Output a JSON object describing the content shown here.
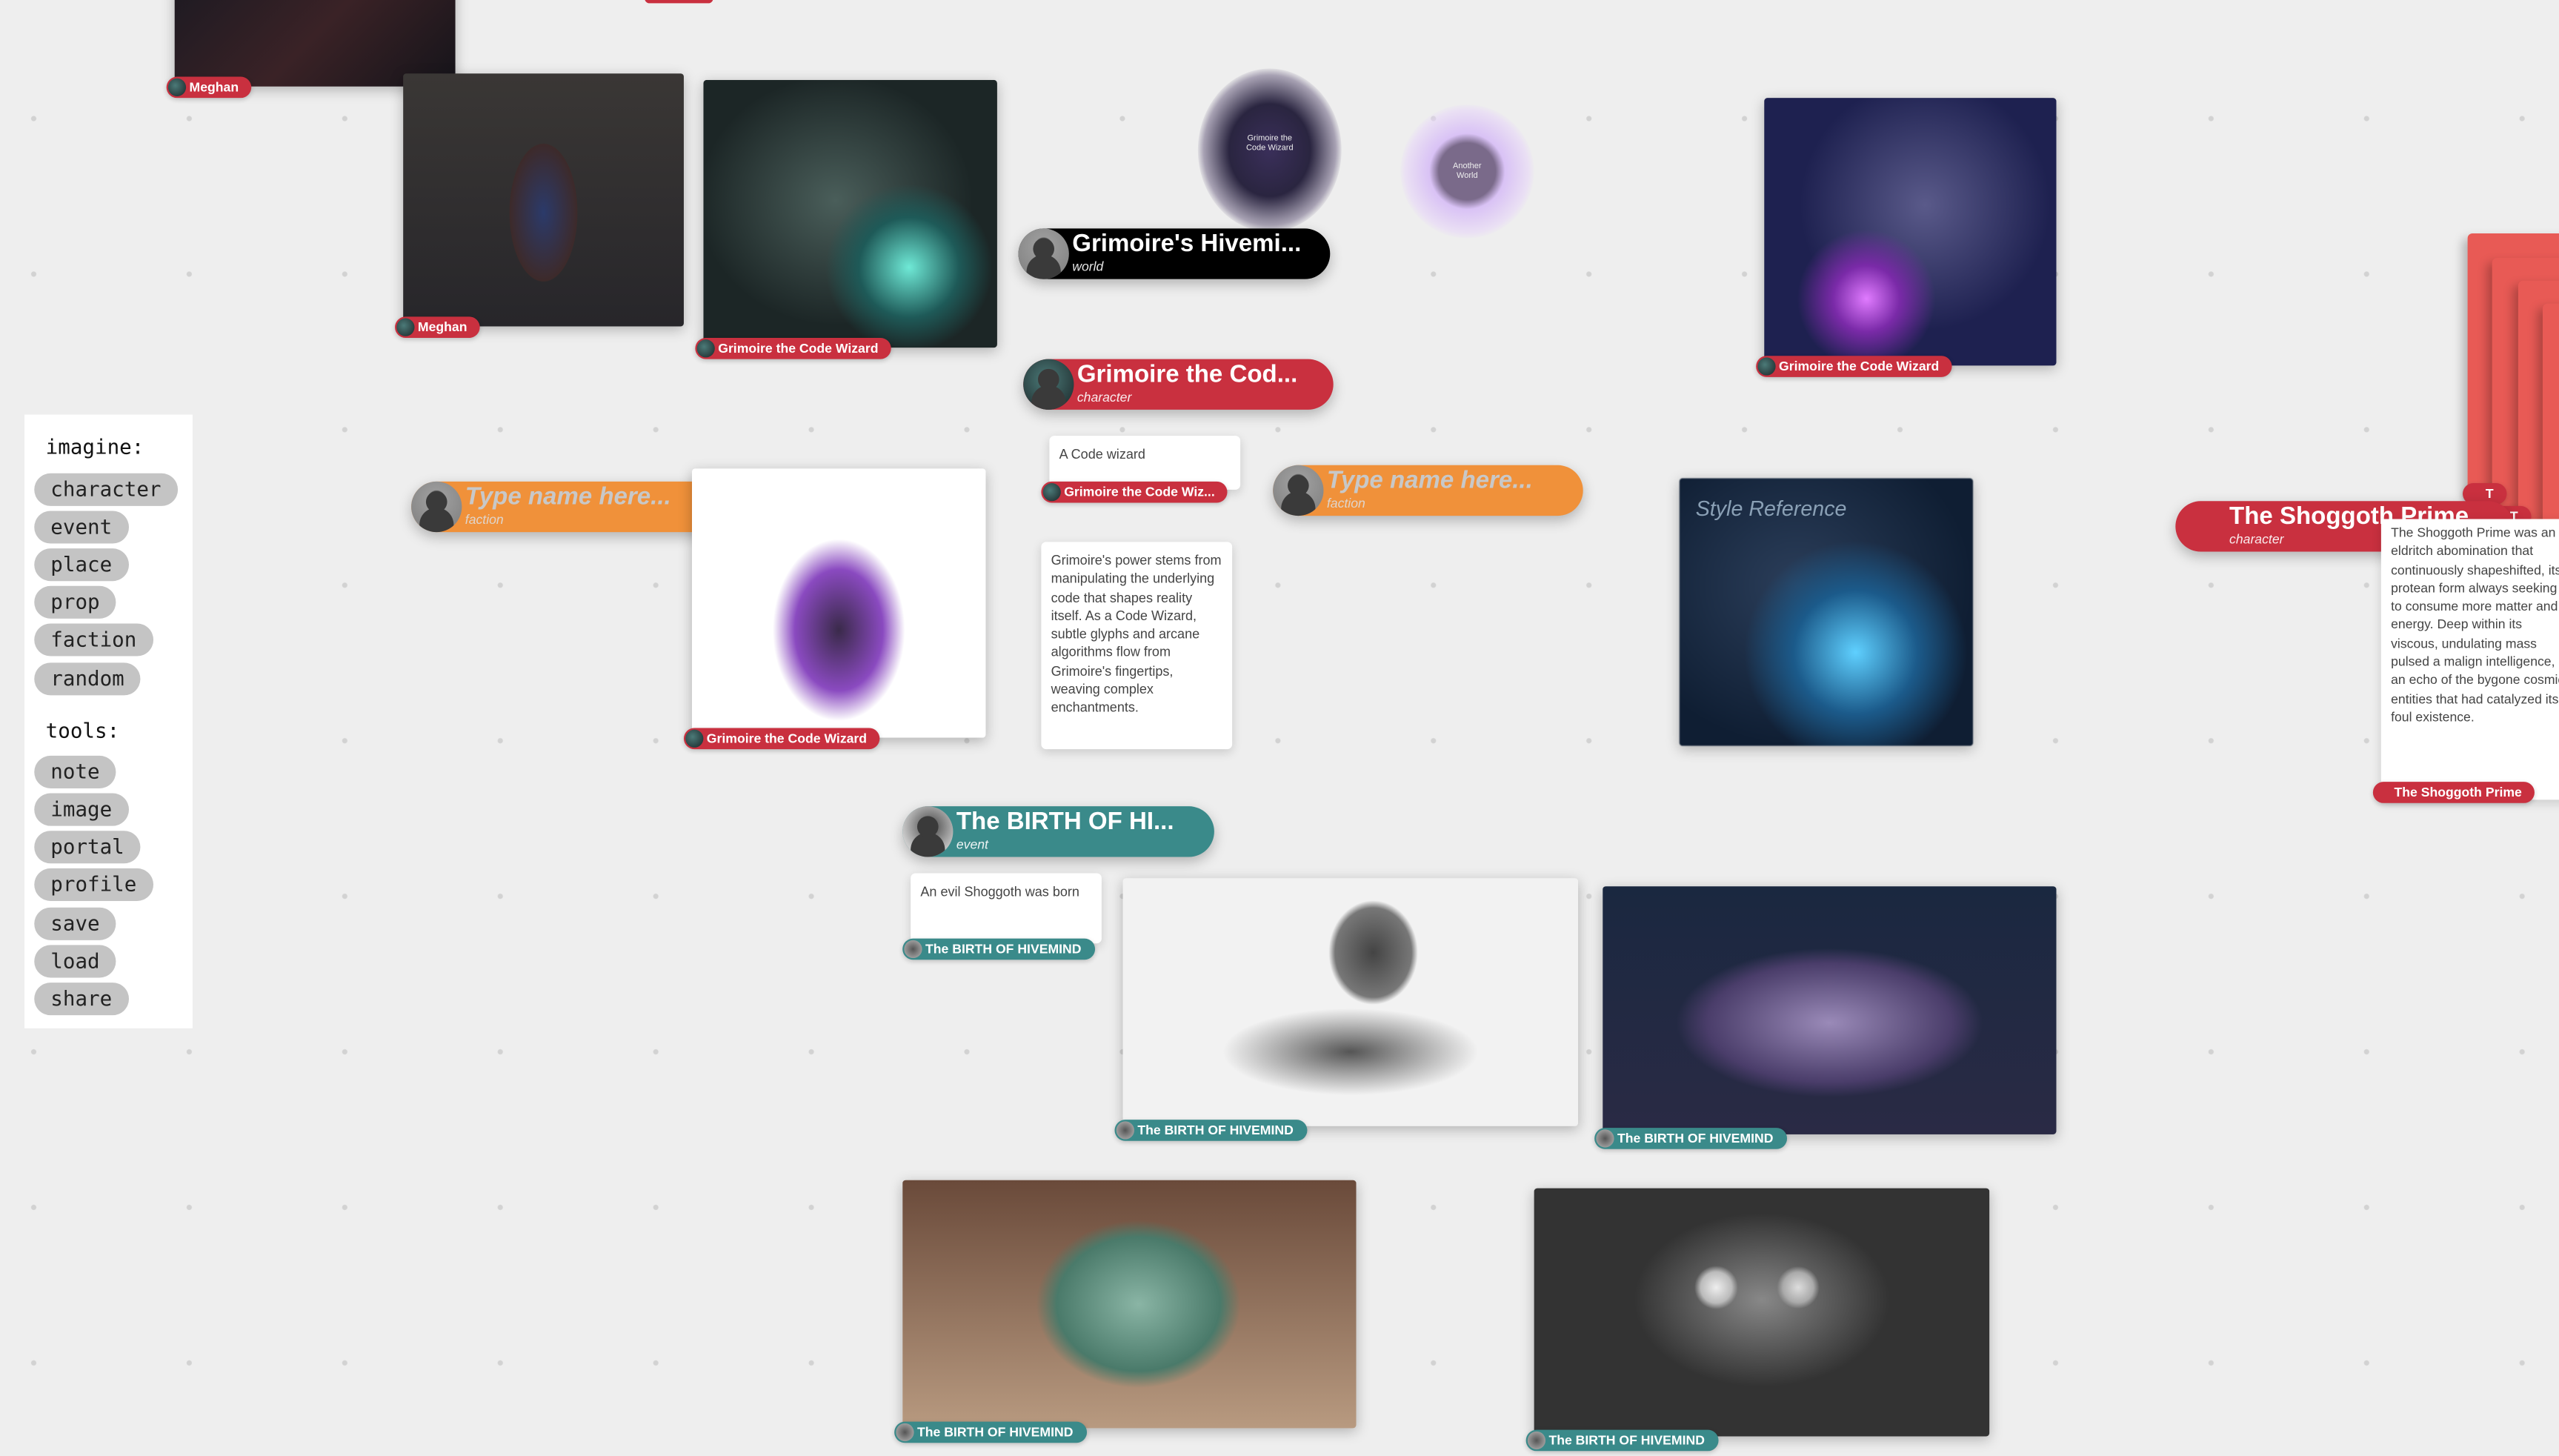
{
  "sidebar": {
    "imagine_heading": "imagine:",
    "imagine_items": [
      "character",
      "event",
      "place",
      "prop",
      "faction",
      "random"
    ],
    "tools_heading": "tools:",
    "tools_items": [
      "note",
      "image",
      "portal",
      "profile",
      "save",
      "load",
      "share"
    ]
  },
  "colors": {
    "character": "#c9303f",
    "event": "#3a8a8a",
    "faction": "#f0913a",
    "world": "#000000",
    "canvas": "#eeeeee"
  },
  "cards": {
    "meghan_top_label": "Meghan",
    "meghan_label": "Meghan",
    "wizard_teal_label": "Grimoire the Code Wizard",
    "wizard_purple_label": "Grimoire the Code Wizard",
    "wizard_white_label": "Grimoire the Code Wizard",
    "portal_text": "Grimoire the Code Wizard",
    "another_world": "Another World",
    "style_reference": "Style Reference",
    "octo_sketch_label": "The BIRTH OF HIVEMIND",
    "coral_label": "The BIRTH OF HIVEMIND",
    "green_octo_label": "The BIRTH OF HIVEMIND",
    "dark_octo_label": "The BIRTH OF HIVEMIND"
  },
  "pills": {
    "world": {
      "title": "Grimoire's Hivemi...",
      "type": "world"
    },
    "character": {
      "title": "Grimoire the Cod...",
      "type": "character"
    },
    "faction1": {
      "placeholder": "Type name here...",
      "type": "faction"
    },
    "faction2": {
      "placeholder": "Type name here...",
      "type": "faction"
    },
    "event": {
      "title": "The BIRTH OF HI...",
      "type": "event"
    },
    "shoggoth": {
      "title": "The Shoggoth Prime",
      "type": "character"
    }
  },
  "notes": {
    "code_wizard": {
      "text": "A Code wizard",
      "label": "Grimoire the Code Wiz..."
    },
    "power": {
      "text": "Grimoire's power stems from manipulating the underlying code that shapes reality itself. As a Code Wizard, subtle glyphs and arcane algorithms flow from Grimoire's fingertips, weaving complex enchantments."
    },
    "shoggoth_born": {
      "text": "An evil Shoggoth was born",
      "label": "The BIRTH OF HIVEMIND"
    },
    "shoggoth_desc": {
      "text": "The Shoggoth Prime was an eldritch abomination that continuously shapeshifted, its protean form always seeking to consume more matter and energy. Deep within its viscous, undulating mass pulsed a malign intelligence, an echo of the bygone cosmic entities that had catalyzed its foul existence.",
      "label": "The Shoggoth Prime"
    }
  },
  "stack_labels": [
    "T",
    "T",
    "T",
    "Th"
  ]
}
